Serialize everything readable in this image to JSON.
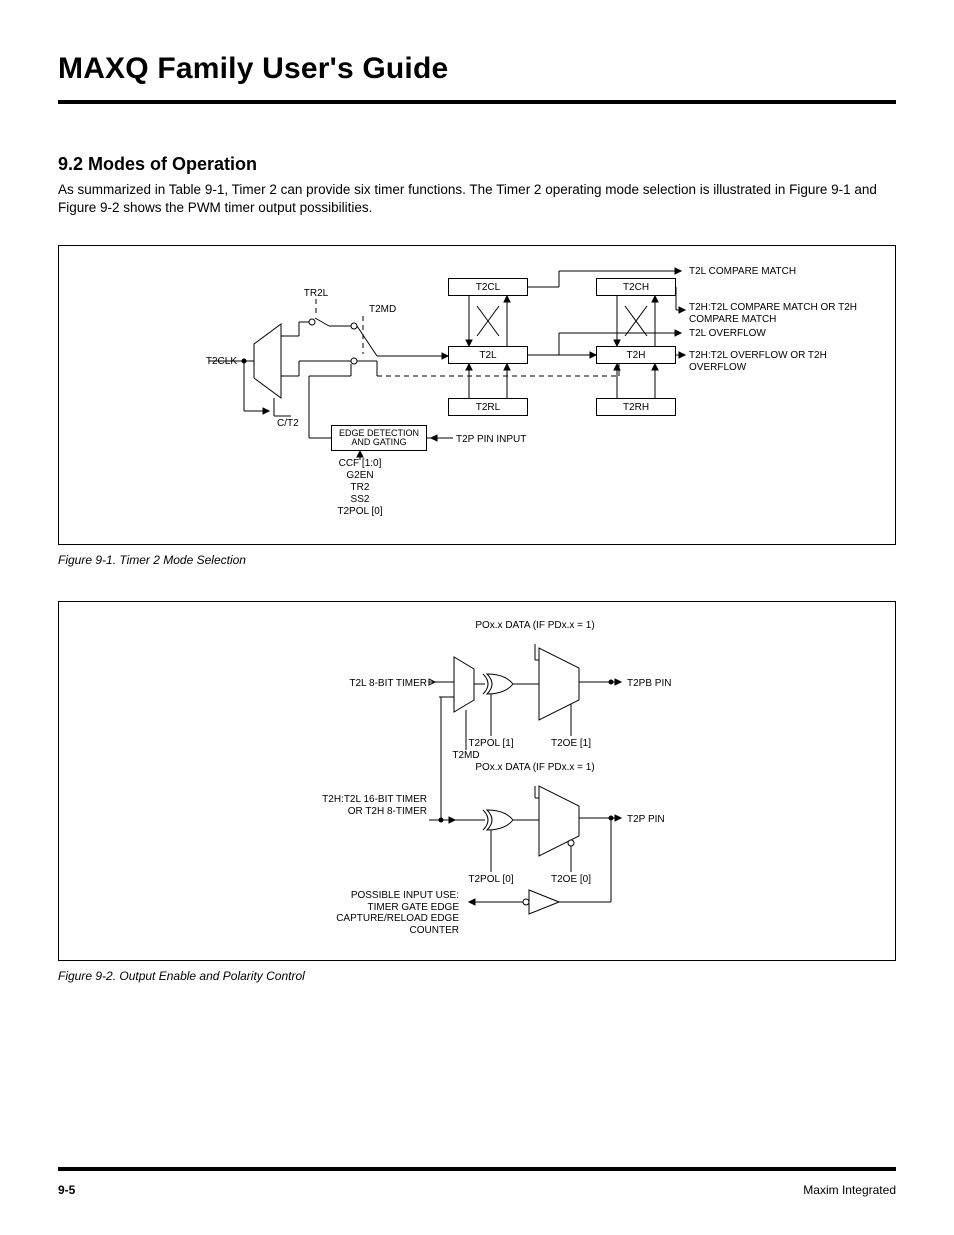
{
  "header": {
    "doc_title": "MAXQ Family User's Guide"
  },
  "section": {
    "heading": "9.2 Modes of Operation",
    "body": "As summarized in Table 9-1, Timer 2 can provide six timer functions. The Timer 2 operating mode selection is illustrated in Figure 9-1 and Figure 9-2 shows the PWM timer output possibilities."
  },
  "figure1": {
    "caption": "Figure 9-1. Timer 2 Mode Selection",
    "labels": {
      "t2clk": "T2CLK",
      "ct2": "C/T2",
      "tr2l": "TR2L",
      "t2md": "T2MD",
      "t2cl": "T2CL",
      "t2ch": "T2CH",
      "t2l": "T2L",
      "t2h": "T2H",
      "t2rl": "T2RL",
      "t2rh": "T2RH",
      "edge": "EDGE DETECTION\nAND GATING",
      "t2p_in": "T2P PIN INPUT",
      "ccf": "CCF [1:0]",
      "g2en": "G2EN",
      "tr2": "TR2",
      "ss2": "SS2",
      "t2pol0": "T2POL [0]",
      "out1": "T2L COMPARE MATCH",
      "out2": "T2H:T2L COMPARE MATCH\nOR T2H COMPARE MATCH",
      "out3": "T2L OVERFLOW",
      "out4": "T2H:T2L OVERFLOW\nOR T2H OVERFLOW"
    }
  },
  "figure2": {
    "caption": "Figure 9-2. Output Enable and Polarity Control",
    "labels": {
      "t2l8": "T2L 8-BIT TIMER",
      "t2md": "T2MD",
      "po_top": "POx.x DATA\n(IF PDx.x = 1)",
      "po_mid": "POx.x DATA\n(IF PDx.x = 1)",
      "t2pol1": "T2POL [1]",
      "t2oe1": "T2OE [1]",
      "t2pb": "T2PB PIN",
      "t2ht2l": "T2H:T2L\n16-BIT TIMER\nOR\nT2H\n8-TIMER",
      "t2pol0": "T2POL [0]",
      "t2oe0": "T2OE [0]",
      "t2p": "T2P PIN",
      "inuse": "POSSIBLE INPUT USE:\nTIMER GATE\nEDGE\nCAPTURE/RELOAD\nEDGE COUNTER"
    }
  },
  "footer": {
    "page_number": "9-5",
    "company": "Maxim Integrated"
  }
}
